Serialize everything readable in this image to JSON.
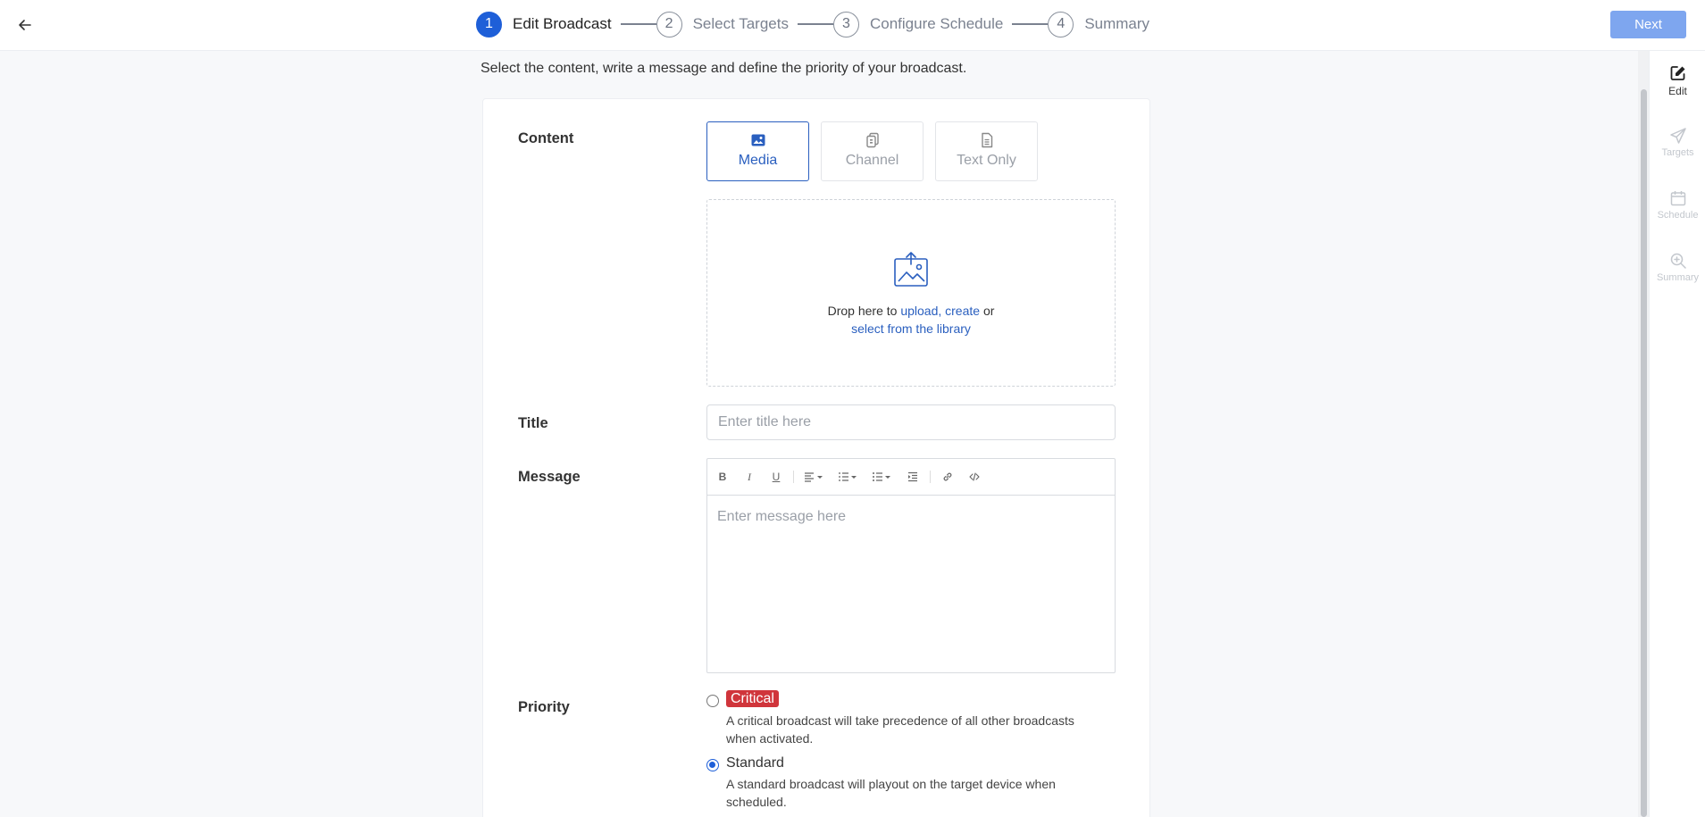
{
  "steps": [
    {
      "number": "1",
      "label": "Edit Broadcast"
    },
    {
      "number": "2",
      "label": "Select Targets"
    },
    {
      "number": "3",
      "label": "Configure Schedule"
    },
    {
      "number": "4",
      "label": "Summary"
    }
  ],
  "header": {
    "next_label": "Next"
  },
  "intro": "Select the content, write a message and define the priority of your broadcast.",
  "form": {
    "content_label": "Content",
    "content_types": [
      {
        "label": "Media"
      },
      {
        "label": "Channel"
      },
      {
        "label": "Text Only"
      }
    ],
    "dropzone": {
      "text_prefix": "Drop here to",
      "upload": "upload,",
      "create": "create",
      "or": "or",
      "library": "select from the library"
    },
    "title_label": "Title",
    "title_placeholder": "Enter title here",
    "message_label": "Message",
    "message_placeholder": "Enter message here",
    "toolbar": {
      "bold": "B",
      "italic": "I",
      "underline": "U"
    },
    "priority_label": "Priority",
    "priorities": [
      {
        "name": "Critical",
        "description": "A critical broadcast will take precedence of all other broadcasts when activated."
      },
      {
        "name": "Standard",
        "description": "A standard broadcast will playout on the target device when scheduled."
      }
    ]
  },
  "sidenav": [
    {
      "label": "Edit"
    },
    {
      "label": "Targets"
    },
    {
      "label": "Schedule"
    },
    {
      "label": "Summary"
    }
  ],
  "colors": {
    "primary": "#1e5fd8",
    "next_button": "#7ea6ef",
    "critical": "#d0353b",
    "link": "#2a5fbf"
  }
}
